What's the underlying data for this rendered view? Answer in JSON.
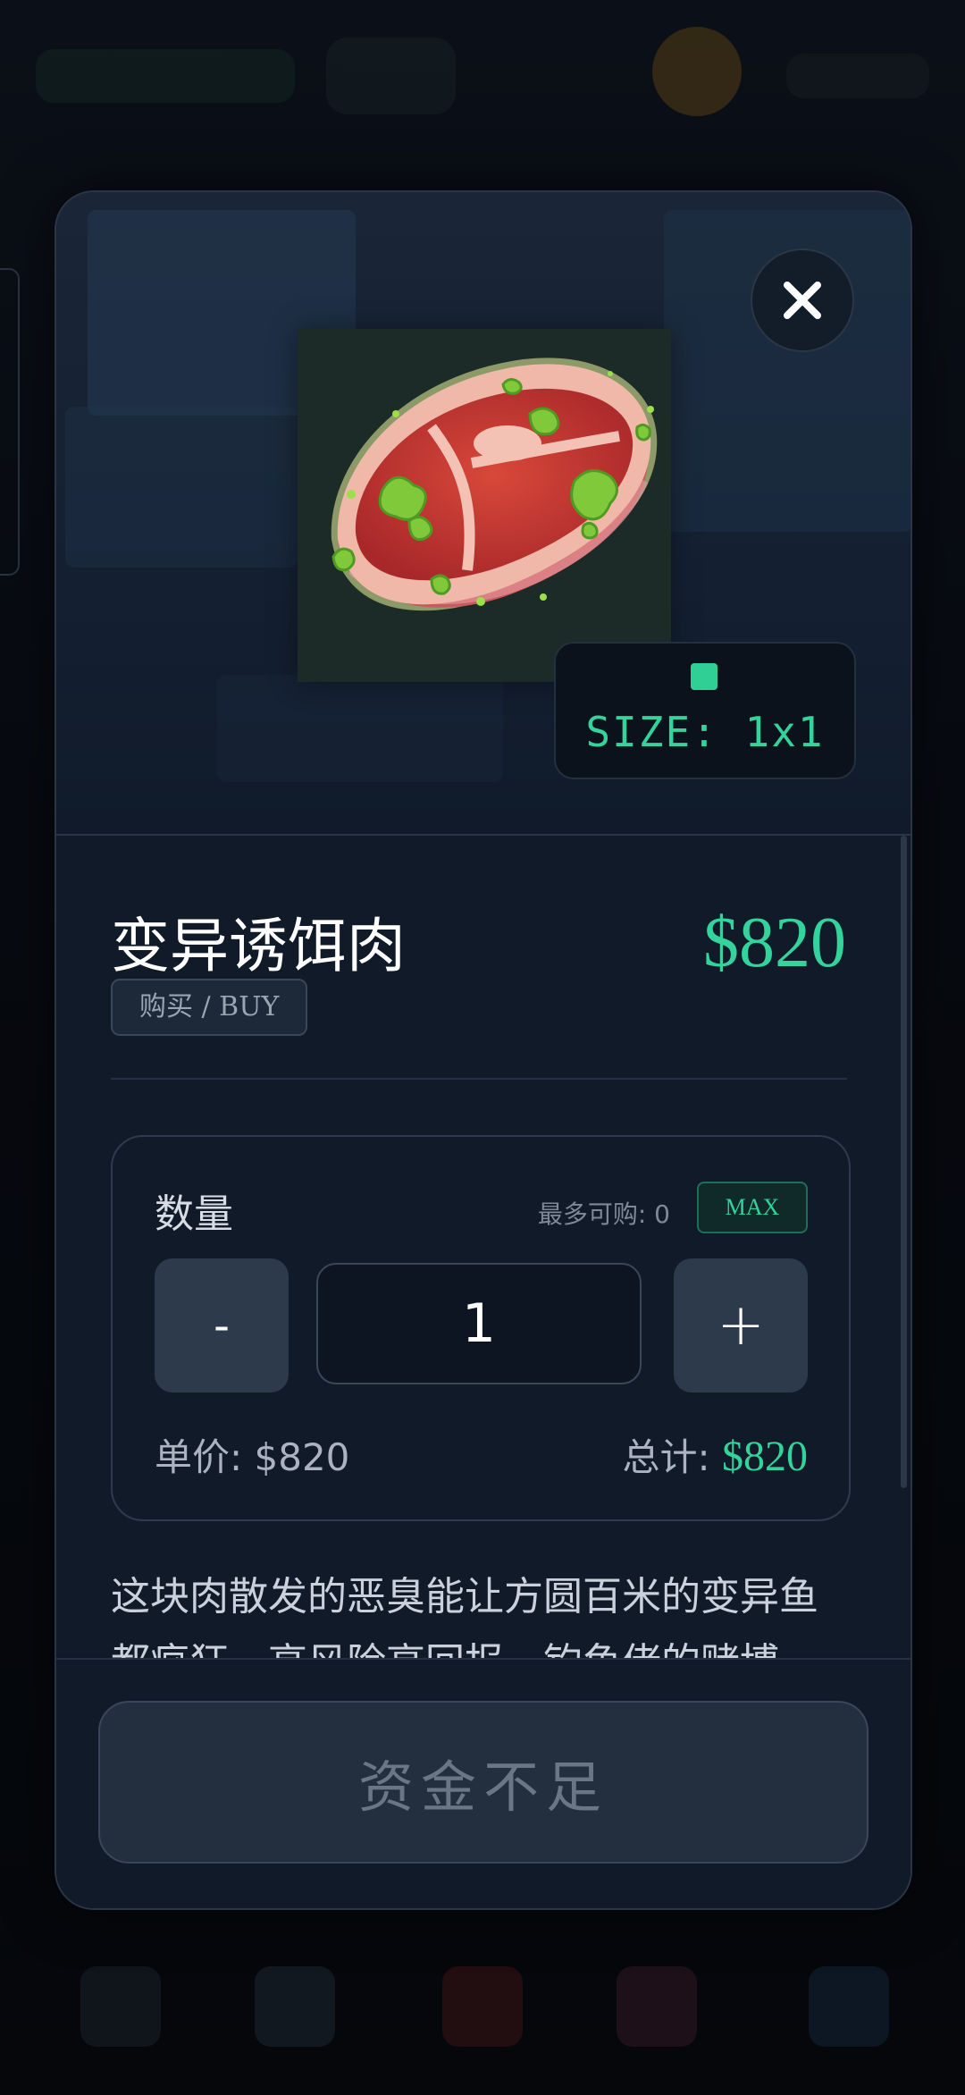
{
  "item": {
    "name": "变异诱饵肉",
    "action_tag": "购买 / BUY",
    "price": "$820",
    "size_label": "SIZE: 1x1"
  },
  "quantity": {
    "label": "数量",
    "max_info": "最多可购: 0",
    "max_button": "MAX",
    "minus": "-",
    "plus": "+",
    "value": "1",
    "unit_price": "单价: $820",
    "total_label": "总计:",
    "total_value": "$820"
  },
  "description": "这块肉散发的恶臭能让方圆百米的变异鱼都疯狂。高风险高回报，钓鱼佬的赌博。",
  "cta": {
    "label": "资金不足"
  },
  "colors": {
    "accent": "#34d39b",
    "panel": "#111a28",
    "disabled": "#6b7684"
  },
  "icons": {
    "close": "close-icon",
    "item": "mutant-meat-icon"
  }
}
